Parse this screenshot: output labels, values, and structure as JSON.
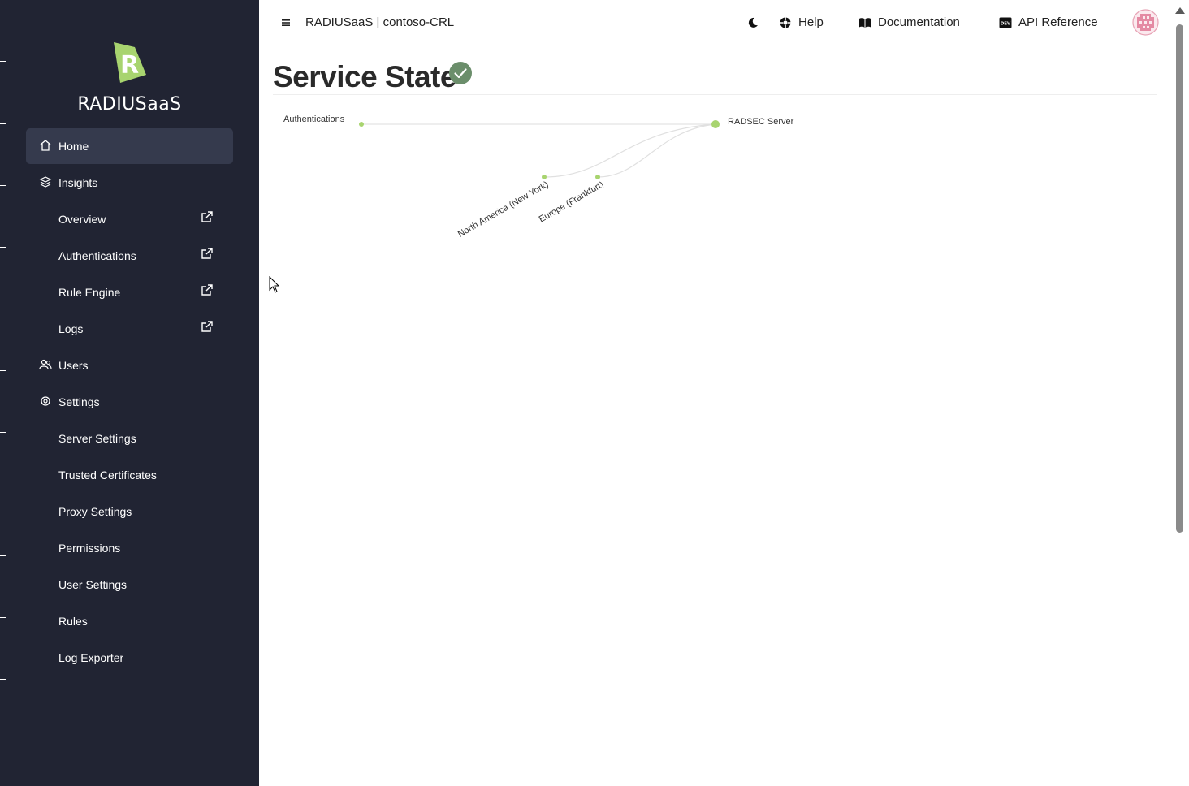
{
  "app": {
    "brand": "RADIUSaaS",
    "title": "RADIUSaaS | contoso-CRL"
  },
  "sidebar": {
    "items": [
      {
        "label": "Home",
        "icon": "home-icon",
        "active": true
      },
      {
        "label": "Insights",
        "icon": "layers-icon"
      },
      {
        "label": "Overview",
        "external": true
      },
      {
        "label": "Authentications",
        "external": true
      },
      {
        "label": "Rule Engine",
        "external": true
      },
      {
        "label": "Logs",
        "external": true
      },
      {
        "label": "Users",
        "icon": "users-icon"
      },
      {
        "label": "Settings",
        "icon": "gear-icon"
      },
      {
        "label": "Server Settings"
      },
      {
        "label": "Trusted Certificates"
      },
      {
        "label": "Proxy Settings"
      },
      {
        "label": "Permissions"
      },
      {
        "label": "User Settings"
      },
      {
        "label": "Rules"
      },
      {
        "label": "Log Exporter"
      }
    ]
  },
  "header": {
    "theme_icon": "moon-icon",
    "help": "Help",
    "documentation": "Documentation",
    "api_reference": "API Reference",
    "avatar_icon": "user-avatar-icon"
  },
  "main": {
    "title": "Service State",
    "status": "ok",
    "status_color": "#6b8e6b"
  },
  "diagram": {
    "nodes": {
      "left": "Authentications",
      "right": "RADSEC Server",
      "region_1": "North America (New York)",
      "region_2": "Europe (Frankfurt)"
    },
    "node_color": "#a8d46f"
  },
  "colors": {
    "sidebar_bg": "#212433",
    "sidebar_active": "#353a4d",
    "accent": "#a8d46f"
  }
}
